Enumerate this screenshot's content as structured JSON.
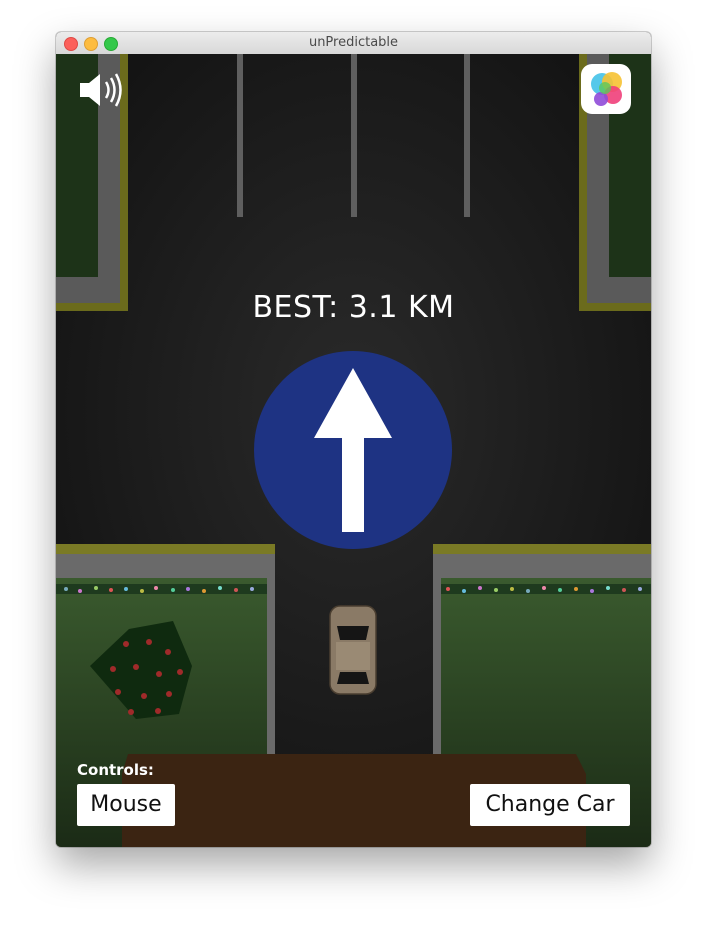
{
  "window": {
    "title": "unPredictable"
  },
  "hud": {
    "best_label": "BEST: 3.1 KM",
    "sound_icon": "speaker-on-icon",
    "game_center_icon": "game-center-icon"
  },
  "sign": {
    "icon": "straight-arrow-icon",
    "color": "#1e3383"
  },
  "controls": {
    "label": "Controls:",
    "mode_button": "Mouse",
    "change_car_button": "Change Car"
  },
  "colors": {
    "road": "#1c1c1c",
    "curb_yellow": "#8a8a1e",
    "grass": "#2c4a22",
    "sign_blue": "#1e3383",
    "car": "#8a7a66",
    "dirt": "#3a2210"
  }
}
